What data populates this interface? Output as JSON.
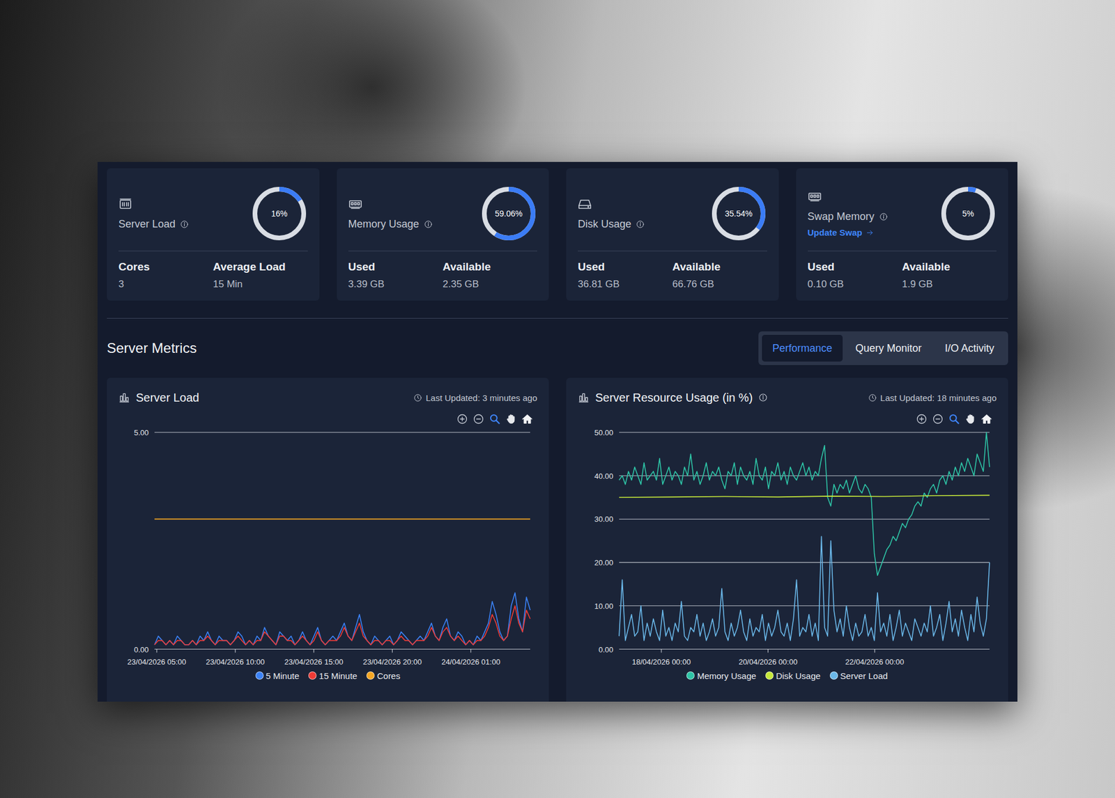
{
  "cards": [
    {
      "kind": "cpu",
      "title": "Server Load",
      "level": 0.16,
      "reading": "16%",
      "stats": [
        {
          "label": "Cores",
          "value": "3"
        },
        {
          "label": "Average Load",
          "value": "15 Min"
        }
      ]
    },
    {
      "kind": "memory",
      "title": "Memory Usage",
      "level": 0.5906,
      "reading": "59.06%",
      "stats": [
        {
          "label": "Used",
          "value": "3.39 GB"
        },
        {
          "label": "Available",
          "value": "2.35 GB"
        }
      ]
    },
    {
      "kind": "disk",
      "title": "Disk Usage",
      "level": 0.3554,
      "reading": "35.54%",
      "stats": [
        {
          "label": "Used",
          "value": "36.81 GB"
        },
        {
          "label": "Available",
          "value": "66.76 GB"
        }
      ]
    },
    {
      "kind": "memory",
      "title": "Swap Memory",
      "level": 0.05,
      "reading": "5%",
      "link": "Update Swap",
      "stats": [
        {
          "label": "Used",
          "value": "0.10 GB"
        },
        {
          "label": "Available",
          "value": "1.9 GB"
        }
      ]
    }
  ],
  "metrics": {
    "title": "Server Metrics",
    "tabs": [
      {
        "label": "Performance",
        "selected": true
      },
      {
        "label": "Query Monitor",
        "selected": false
      },
      {
        "label": "I/O Activity",
        "selected": false
      }
    ]
  },
  "charts": [
    {
      "title": "Server Load",
      "updated": "Last Updated: 3 minutes ago",
      "y_ticks": [
        "0.00",
        "5.00"
      ],
      "x_ticks": [
        "23/04/2026 05:00",
        "23/04/2026 10:00",
        "23/04/2026 15:00",
        "23/04/2026 20:00",
        "24/04/2026 01:00"
      ],
      "series": [
        {
          "name": "5 Minute",
          "color": "#3b82f6",
          "values": [
            0.1,
            0.3,
            0.2,
            0.1,
            0.2,
            0.1,
            0.3,
            0.2,
            0.1,
            0.1,
            0.2,
            0.1,
            0.3,
            0.2,
            0.4,
            0.2,
            0.1,
            0.3,
            0.2,
            0.2,
            0.1,
            0.2,
            0.4,
            0.3,
            0.1,
            0.2,
            0.1,
            0.3,
            0.2,
            0.5,
            0.3,
            0.2,
            0.1,
            0.4,
            0.3,
            0.2,
            0.3,
            0.1,
            0.2,
            0.4,
            0.2,
            0.1,
            0.3,
            0.5,
            0.2,
            0.1,
            0.2,
            0.3,
            0.2,
            0.4,
            0.6,
            0.3,
            0.2,
            0.5,
            0.8,
            0.4,
            0.2,
            0.1,
            0.3,
            0.2,
            0.1,
            0.2,
            0.3,
            0.1,
            0.2,
            0.4,
            0.3,
            0.2,
            0.1,
            0.2,
            0.3,
            0.2,
            0.4,
            0.6,
            0.3,
            0.2,
            0.5,
            0.7,
            0.3,
            0.2,
            0.4,
            0.3,
            0.1,
            0.2,
            0.1,
            0.3,
            0.2,
            0.4,
            0.6,
            1.1,
            0.8,
            0.4,
            0.2,
            0.3,
            1.0,
            1.3,
            0.7,
            0.4,
            1.2,
            0.9
          ]
        },
        {
          "name": "15 Minute",
          "color": "#ef3b36",
          "values": [
            0.1,
            0.2,
            0.2,
            0.1,
            0.2,
            0.1,
            0.2,
            0.2,
            0.1,
            0.1,
            0.2,
            0.1,
            0.2,
            0.2,
            0.3,
            0.2,
            0.1,
            0.2,
            0.2,
            0.2,
            0.1,
            0.2,
            0.3,
            0.2,
            0.1,
            0.2,
            0.1,
            0.2,
            0.2,
            0.4,
            0.3,
            0.2,
            0.1,
            0.3,
            0.3,
            0.2,
            0.2,
            0.1,
            0.2,
            0.3,
            0.2,
            0.1,
            0.2,
            0.4,
            0.2,
            0.1,
            0.2,
            0.2,
            0.2,
            0.3,
            0.5,
            0.3,
            0.2,
            0.4,
            0.6,
            0.3,
            0.2,
            0.1,
            0.2,
            0.2,
            0.1,
            0.2,
            0.2,
            0.1,
            0.2,
            0.3,
            0.2,
            0.2,
            0.1,
            0.2,
            0.2,
            0.2,
            0.3,
            0.5,
            0.3,
            0.2,
            0.4,
            0.5,
            0.3,
            0.2,
            0.3,
            0.2,
            0.1,
            0.2,
            0.1,
            0.2,
            0.2,
            0.3,
            0.5,
            0.8,
            0.6,
            0.3,
            0.2,
            0.3,
            0.7,
            1.0,
            0.6,
            0.4,
            0.9,
            0.7
          ]
        },
        {
          "name": "Cores",
          "color": "#f5a623",
          "values": [
            3,
            3
          ]
        }
      ]
    },
    {
      "title": "Server Resource Usage (in %)",
      "updated": "Last Updated: 18 minutes ago",
      "y_ticks": [
        "0.00",
        "10.00",
        "20.00",
        "30.00",
        "40.00",
        "50.00"
      ],
      "x_ticks": [
        "18/04/2026 00:00",
        "20/04/2026 00:00",
        "22/04/2026 00:00"
      ],
      "series": [
        {
          "name": "Memory Usage",
          "color": "#2ec4a6",
          "values": [
            39,
            40,
            38,
            41,
            39,
            42,
            40,
            38,
            43,
            39,
            40,
            41,
            39,
            44,
            38,
            40,
            42,
            39,
            41,
            40,
            38,
            42,
            40,
            45,
            39,
            41,
            38,
            40,
            43,
            39,
            41,
            40,
            42,
            39,
            37,
            41,
            40,
            43,
            38,
            42,
            40,
            39,
            41,
            38,
            44,
            40,
            39,
            42,
            37,
            41,
            40,
            43,
            39,
            41,
            38,
            42,
            40,
            39,
            41,
            43,
            40,
            42,
            39,
            41,
            40,
            44,
            47,
            35,
            33,
            38,
            36,
            38,
            37,
            39,
            36,
            38,
            40,
            37,
            36,
            38,
            37,
            35,
            22,
            17,
            19,
            21,
            23,
            24,
            26,
            25,
            27,
            29,
            28,
            30,
            31,
            33,
            34,
            33,
            36,
            35,
            37,
            38,
            36,
            39,
            40,
            38,
            41,
            39,
            42,
            40,
            43,
            41,
            44,
            42,
            40,
            45,
            43,
            41,
            50,
            42
          ]
        },
        {
          "name": "Disk Usage",
          "color": "#c6e83a",
          "values": [
            35.0,
            35.1,
            35.2,
            35.1,
            35.3,
            35.2,
            35.4,
            35.5
          ]
        },
        {
          "name": "Server Load",
          "color": "#6ab7e8",
          "values": [
            3,
            16,
            2,
            5,
            8,
            3,
            4,
            10,
            2,
            6,
            3,
            7,
            4,
            2,
            9,
            3,
            5,
            2,
            6,
            4,
            11,
            3,
            2,
            5,
            4,
            8,
            3,
            6,
            2,
            4,
            7,
            3,
            5,
            14,
            4,
            2,
            6,
            3,
            5,
            9,
            4,
            2,
            7,
            3,
            5,
            4,
            8,
            2,
            6,
            3,
            5,
            9,
            4,
            3,
            6,
            2,
            7,
            16,
            3,
            5,
            4,
            8,
            3,
            6,
            2,
            26,
            5,
            3,
            25,
            9,
            4,
            7,
            3,
            10,
            5,
            2,
            6,
            3,
            4,
            8,
            3,
            5,
            2,
            13,
            4,
            6,
            3,
            8,
            2,
            5,
            9,
            3,
            6,
            4,
            2,
            7,
            5,
            3,
            6,
            4,
            10,
            3,
            5,
            8,
            2,
            6,
            11,
            4,
            7,
            3,
            9,
            5,
            2,
            8,
            4,
            12,
            6,
            3,
            7,
            20
          ]
        }
      ]
    }
  ]
}
